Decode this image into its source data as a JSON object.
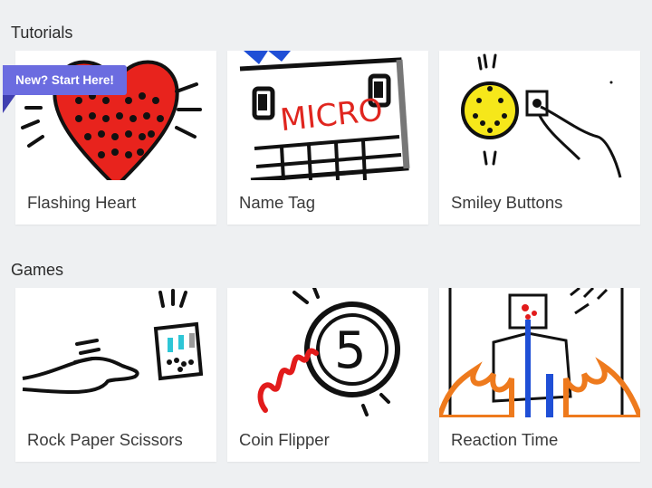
{
  "sections": {
    "tutorials": {
      "title": "Tutorials",
      "badge": "New? Start Here!",
      "cards": [
        {
          "label": "Flashing Heart",
          "icon": "heart-icon"
        },
        {
          "label": "Name Tag",
          "icon": "name-tag-icon",
          "thumb_text": "MICRO"
        },
        {
          "label": "Smiley Buttons",
          "icon": "smiley-button-icon"
        }
      ]
    },
    "games": {
      "title": "Games",
      "cards": [
        {
          "label": "Rock Paper Scissors",
          "icon": "hand-gesture-icon"
        },
        {
          "label": "Coin Flipper",
          "icon": "coin-icon",
          "thumb_text": "5"
        },
        {
          "label": "Reaction Time",
          "icon": "reaction-time-icon"
        }
      ]
    }
  },
  "colors": {
    "background": "#eef0f2",
    "card": "#ffffff",
    "badge": "#6b6ce0",
    "badge_fold": "#3f3fb0",
    "heart_red": "#e8231d",
    "smiley_yellow": "#f6e71a",
    "coin_red": "#e21b1b",
    "flame_orange": "#ee7a1d",
    "micro_red": "#e0261f"
  }
}
